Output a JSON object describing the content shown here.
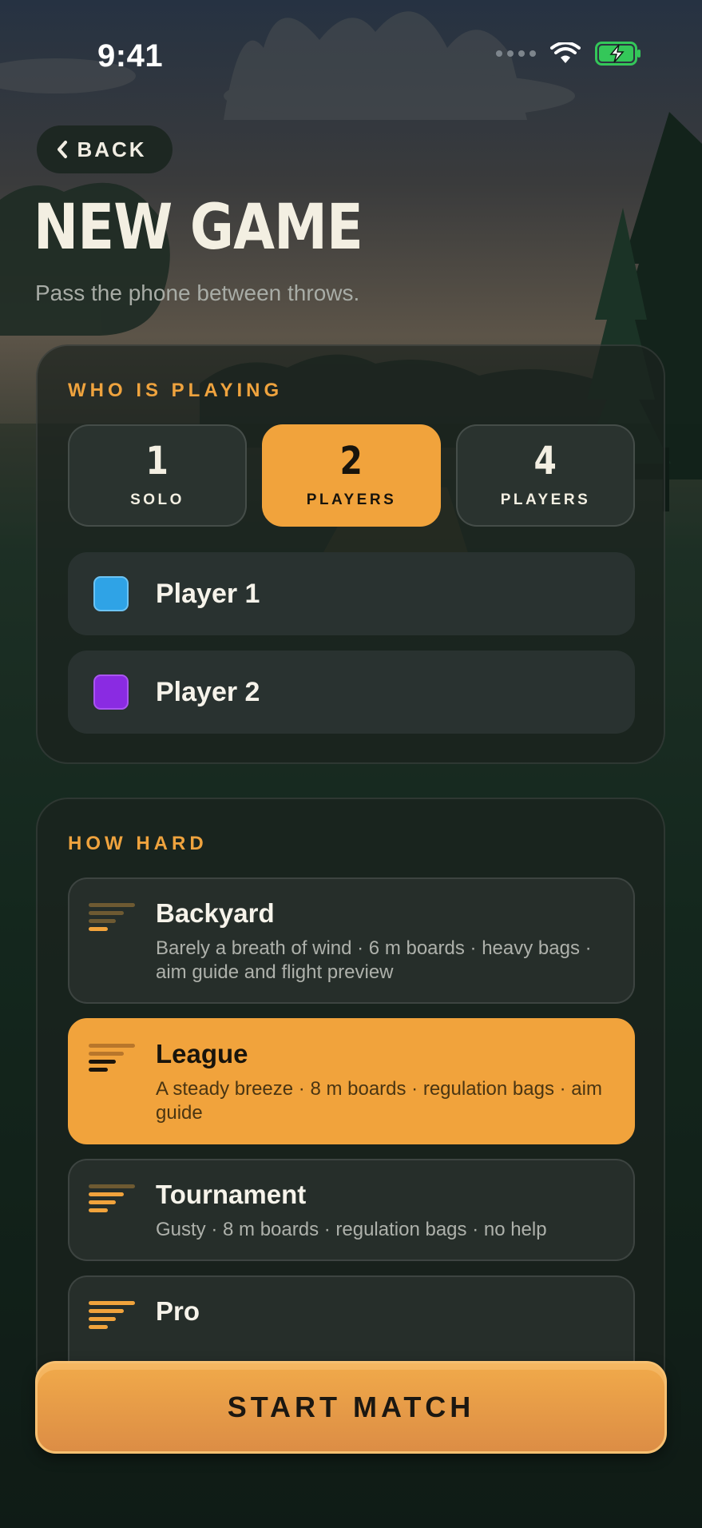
{
  "status_bar": {
    "time": "9:41",
    "wifi_icon": "wifi-icon",
    "battery_icon": "battery-charging-icon",
    "battery_color": "#34c759"
  },
  "header": {
    "back_label": "BACK",
    "title": "NEW GAME",
    "subtitle": "Pass the phone between throws."
  },
  "players_section": {
    "label": "WHO IS PLAYING",
    "options": [
      {
        "count": "1",
        "label": "SOLO",
        "selected": false
      },
      {
        "count": "2",
        "label": "PLAYERS",
        "selected": true
      },
      {
        "count": "4",
        "label": "PLAYERS",
        "selected": false
      }
    ],
    "players": [
      {
        "name": "Player 1",
        "color": "#2fa3e6"
      },
      {
        "name": "Player 2",
        "color": "#8a2be2"
      }
    ]
  },
  "difficulty_section": {
    "label": "HOW HARD",
    "options": [
      {
        "name": "Backyard",
        "description": "Barely a breath of wind · 6 m boards · heavy bags · aim guide and flight preview",
        "level": 1,
        "selected": false
      },
      {
        "name": "League",
        "description": "A steady breeze · 8 m boards · regulation bags · aim guide",
        "level": 2,
        "selected": true
      },
      {
        "name": "Tournament",
        "description": "Gusty · 8 m boards · regulation bags · no help",
        "level": 3,
        "selected": false
      },
      {
        "name": "Pro",
        "description": "",
        "level": 4,
        "selected": false
      }
    ]
  },
  "footer": {
    "start_label": "START MATCH"
  },
  "colors": {
    "accent": "#f1a33c",
    "text": "#f3efe2",
    "panel": "#1b221e"
  }
}
